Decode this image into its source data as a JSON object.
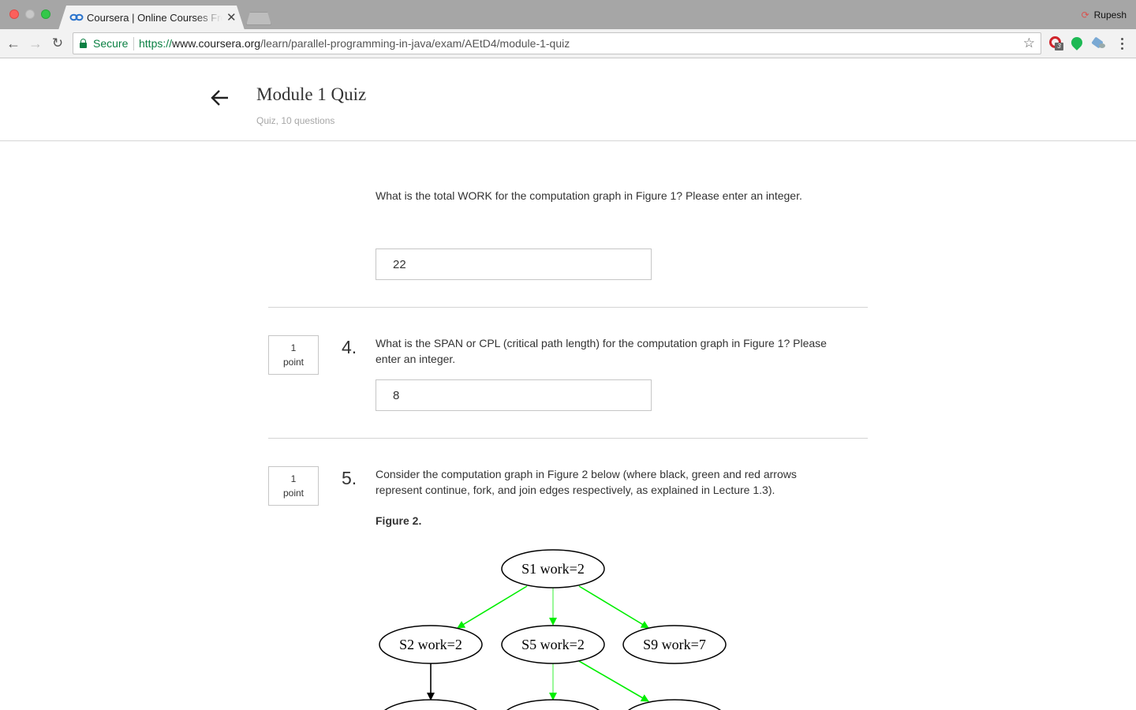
{
  "browser": {
    "tab_title": "Coursera | Online Courses From Top Universities",
    "profile_name": "Rupesh",
    "secure_label": "Secure",
    "url_scheme": "https://",
    "url_host": "www.coursera.org",
    "url_path": "/learn/parallel-programming-in-java/exam/AEtD4/module-1-quiz",
    "extension_badge": "3"
  },
  "header": {
    "title": "Module 1 Quiz",
    "subtitle": "Quiz, 10 questions"
  },
  "questions": [
    {
      "text": "What is the total WORK for the computation graph in Figure 1? Please enter an integer.",
      "answer": "22"
    },
    {
      "number": "4.",
      "points_value": "1",
      "points_unit": "point",
      "text": "What is the SPAN or CPL (critical path length) for the computation graph in Figure 1? Please enter an integer.",
      "answer": "8"
    },
    {
      "number": "5.",
      "points_value": "1",
      "points_unit": "point",
      "text": "Consider the computation graph in Figure 2 below (where black, green and red arrows represent continue, fork, and join edges respectively, as explained in Lecture 1.3).",
      "figure_label": "Figure 2."
    }
  ],
  "figure2": {
    "nodes": [
      "S1 work=2",
      "S2 work=2",
      "S5 work=2",
      "S9 work=7"
    ],
    "colors": {
      "fork": "#00ee00",
      "continue": "#000000"
    }
  },
  "colors": {
    "secure_green": "#0b8043",
    "text": "#333333",
    "subtle": "#a7a7a7"
  }
}
